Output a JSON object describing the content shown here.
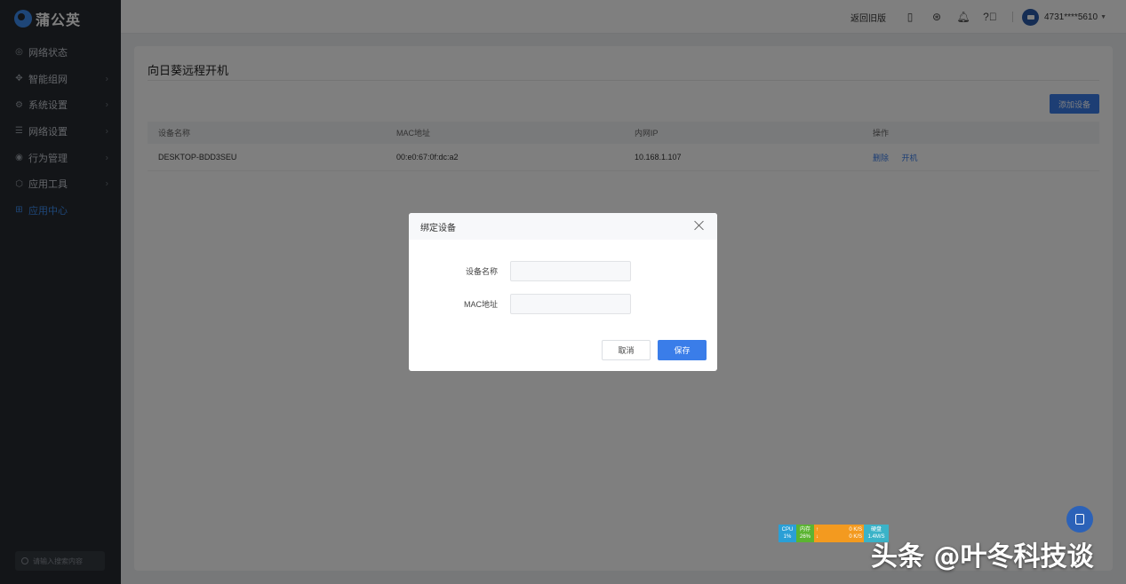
{
  "app": {
    "logo_text": "蒲公英"
  },
  "sidebar": {
    "items": [
      {
        "label": "网络状态",
        "icon": "globe-icon",
        "has_chevron": false,
        "active": false
      },
      {
        "label": "智能组网",
        "icon": "network-icon",
        "has_chevron": true,
        "active": false
      },
      {
        "label": "系统设置",
        "icon": "gear-icon",
        "has_chevron": true,
        "active": false
      },
      {
        "label": "网络设置",
        "icon": "sliders-icon",
        "has_chevron": true,
        "active": false
      },
      {
        "label": "行为管理",
        "icon": "eye-icon",
        "has_chevron": true,
        "active": false
      },
      {
        "label": "应用工具",
        "icon": "shield-icon",
        "has_chevron": true,
        "active": false
      },
      {
        "label": "应用中心",
        "icon": "apps-icon",
        "has_chevron": false,
        "active": true
      }
    ],
    "search_placeholder": "请输入搜索内容"
  },
  "topbar": {
    "back_link": "返回旧版",
    "account": "4731****5610"
  },
  "page": {
    "title": "向日葵远程开机",
    "add_button": "添加设备",
    "table": {
      "headers": [
        "设备名称",
        "MAC地址",
        "内网IP",
        "操作"
      ],
      "rows": [
        {
          "name": "DESKTOP-BDD3SEU",
          "mac": "00:e0:67:0f:dc:a2",
          "ip": "10.168.1.107",
          "actions": [
            "删除",
            "开机"
          ]
        }
      ]
    }
  },
  "dialog": {
    "title": "绑定设备",
    "fields": [
      {
        "label": "设备名称",
        "value": "",
        "placeholder": ""
      },
      {
        "label": "MAC地址",
        "value": "",
        "placeholder": ""
      }
    ],
    "cancel_label": "取消",
    "save_label": "保存"
  },
  "monitor": {
    "cpu_label": "CPU",
    "cpu_value": "1%",
    "mem_label": "内存",
    "mem_value": "26%",
    "up_arrow": "↑",
    "down_arrow": "↓",
    "up_speed": "0 K/S",
    "down_speed": "0 K/S",
    "disk_label": "硬盘",
    "disk_value": "1.4M/S"
  },
  "watermark": "头条 @叶冬科技谈"
}
